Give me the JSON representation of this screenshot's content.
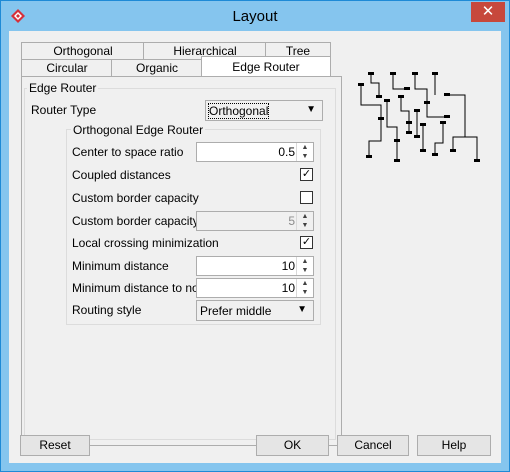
{
  "window": {
    "title": "Layout"
  },
  "tabs_row1": [
    "Orthogonal",
    "Hierarchical",
    "Tree"
  ],
  "tabs_row2": [
    "Circular",
    "Organic",
    "Edge Router"
  ],
  "edge_router": {
    "group_title": "Edge Router",
    "router_type_label": "Router Type",
    "router_type_value": "Orthogonal",
    "orth_group_title": "Orthogonal Edge Router",
    "rows": {
      "center_ratio": {
        "label": "Center to space ratio",
        "value": "0.5"
      },
      "coupled": {
        "label": "Coupled distances",
        "checked": "✓"
      },
      "custom_border_cb": {
        "label": "Custom border capacity",
        "checked": ""
      },
      "custom_border_val": {
        "label": "Custom border capacity",
        "value": "5"
      },
      "local_crossing": {
        "label": "Local crossing minimization",
        "checked": "✓"
      },
      "min_distance": {
        "label": "Minimum distance",
        "value": "10"
      },
      "min_distance_node": {
        "label": "Minimum distance to node",
        "value": "10"
      },
      "routing_style": {
        "label": "Routing style",
        "value": "Prefer middle"
      }
    }
  },
  "buttons": {
    "reset": "Reset",
    "ok": "OK",
    "cancel": "Cancel",
    "help": "Help"
  }
}
